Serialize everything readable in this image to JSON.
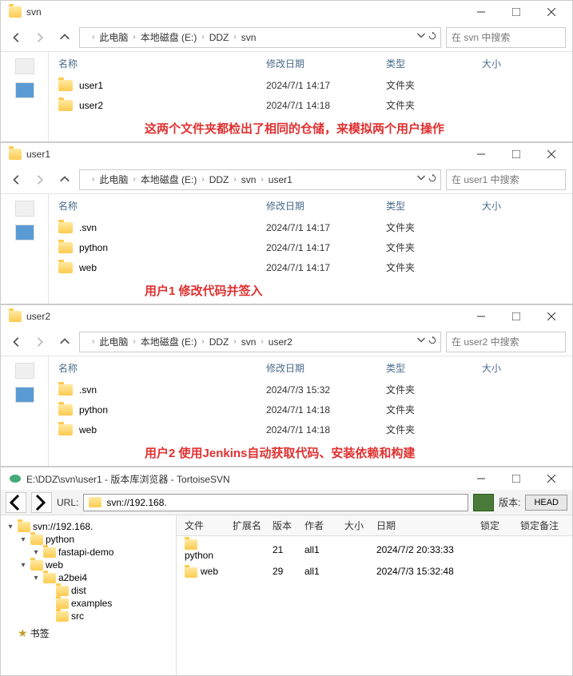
{
  "explorer": [
    {
      "title": "svn",
      "breadcrumb": [
        "此电脑",
        "本地磁盘 (E:)",
        "DDZ",
        "svn"
      ],
      "search_placeholder": "在 svn 中搜索",
      "columns": {
        "name": "名称",
        "date": "修改日期",
        "type": "类型",
        "size": "大小"
      },
      "rows": [
        {
          "name": "user1",
          "date": "2024/7/1 14:17",
          "type": "文件夹"
        },
        {
          "name": "user2",
          "date": "2024/7/1 14:18",
          "type": "文件夹"
        }
      ],
      "annotation": "这两个文件夹都检出了相同的仓储，来模拟两个用户操作"
    },
    {
      "title": "user1",
      "breadcrumb": [
        "此电脑",
        "本地磁盘 (E:)",
        "DDZ",
        "svn",
        "user1"
      ],
      "search_placeholder": "在 user1 中搜索",
      "columns": {
        "name": "名称",
        "date": "修改日期",
        "type": "类型",
        "size": "大小"
      },
      "rows": [
        {
          "name": ".svn",
          "date": "2024/7/1 14:17",
          "type": "文件夹"
        },
        {
          "name": "python",
          "date": "2024/7/1 14:17",
          "type": "文件夹"
        },
        {
          "name": "web",
          "date": "2024/7/1 14:17",
          "type": "文件夹"
        }
      ],
      "annotation": "用户1 修改代码并签入"
    },
    {
      "title": "user2",
      "breadcrumb": [
        "此电脑",
        "本地磁盘 (E:)",
        "DDZ",
        "svn",
        "user2"
      ],
      "search_placeholder": "在 user2 中搜索",
      "columns": {
        "name": "名称",
        "date": "修改日期",
        "type": "类型",
        "size": "大小"
      },
      "rows": [
        {
          "name": ".svn",
          "date": "2024/7/3 15:32",
          "type": "文件夹"
        },
        {
          "name": "python",
          "date": "2024/7/1 14:18",
          "type": "文件夹"
        },
        {
          "name": "web",
          "date": "2024/7/1 14:18",
          "type": "文件夹"
        }
      ],
      "annotation": "用户2 使用Jenkins自动获取代码、安装依赖和构建"
    }
  ],
  "tortoise": {
    "title": "E:\\DDZ\\svn\\user1 - 版本库浏览器 - TortoiseSVN",
    "url_label": "URL:",
    "url_value": "svn://192.168.",
    "version_label": "版本:",
    "head": "HEAD",
    "tree": [
      {
        "lvl": 0,
        "exp": "▾",
        "label": "svn://192.168."
      },
      {
        "lvl": 1,
        "exp": "▾",
        "label": "python"
      },
      {
        "lvl": 2,
        "exp": "▾",
        "label": "fastapi-demo"
      },
      {
        "lvl": 1,
        "exp": "▾",
        "label": "web"
      },
      {
        "lvl": 2,
        "exp": "▾",
        "label": "a2bei4"
      },
      {
        "lvl": 3,
        "exp": "",
        "label": "dist"
      },
      {
        "lvl": 3,
        "exp": "",
        "label": "examples"
      },
      {
        "lvl": 3,
        "exp": "",
        "label": "src"
      }
    ],
    "bookmark": "书签",
    "lv_columns": {
      "file": "文件",
      "ext": "扩展名",
      "ver": "版本",
      "author": "作者",
      "size": "大小",
      "date": "日期",
      "lock": "锁定",
      "lockc": "锁定备注"
    },
    "lv_rows": [
      {
        "file": "python",
        "ver": "21",
        "author": "all1",
        "date": "2024/7/2 20:33:33"
      },
      {
        "file": "web",
        "ver": "29",
        "author": "all1",
        "date": "2024/7/3 15:32:48"
      }
    ]
  }
}
